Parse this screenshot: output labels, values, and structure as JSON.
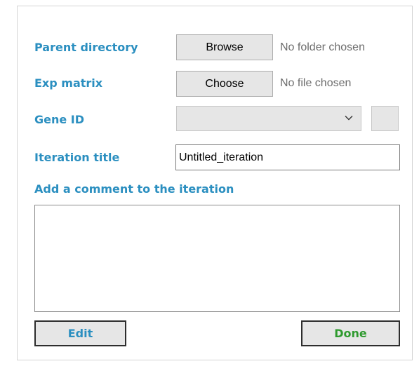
{
  "form": {
    "parent_directory": {
      "label": "Parent directory",
      "button": "Browse",
      "status": "No folder chosen"
    },
    "exp_matrix": {
      "label": "Exp matrix",
      "button": "Choose",
      "status": "No file chosen"
    },
    "gene_id": {
      "label": "Gene ID",
      "selected": ""
    },
    "iteration_title": {
      "label": "Iteration title",
      "value": "Untitled_iteration"
    },
    "comment": {
      "label": "Add a comment to the iteration",
      "value": ""
    },
    "actions": {
      "edit_label": "Edit",
      "done_label": "Done"
    }
  },
  "colors": {
    "label_blue": "#2b8fc0",
    "edit_text": "#2b8fc0",
    "done_text": "#2e9a2e",
    "button_bg": "#e6e6e6",
    "status_gray": "#6d6d6d"
  },
  "icons": {
    "dropdown": "chevron-down-icon"
  }
}
